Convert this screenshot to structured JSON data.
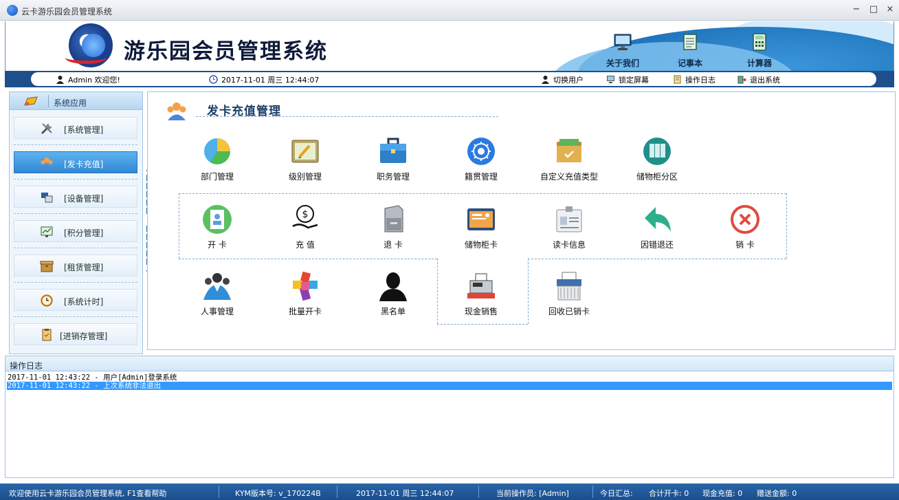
{
  "window": {
    "title": "云卡游乐园会员管理系统",
    "minimize": "−",
    "maximize": "□",
    "close": "×"
  },
  "header": {
    "brand": "游乐园会员管理系统",
    "tools": [
      {
        "label": "关于我们",
        "icon": "monitor-icon"
      },
      {
        "label": "记事本",
        "icon": "notepad-icon"
      },
      {
        "label": "计算器",
        "icon": "calculator-icon"
      }
    ]
  },
  "infobar": {
    "welcome": "Admin 欢迎您!",
    "datetime": "2017-11-01 周三 12:44:07",
    "switch_user": "切换用户",
    "lock_screen": "锁定屏幕",
    "op_log": "操作日志",
    "exit": "退出系统"
  },
  "sidebar": {
    "header": "系统应用",
    "items": [
      {
        "label": "[系统管理]",
        "icon": "tools-icon",
        "active": false
      },
      {
        "label": "[发卡充值]",
        "icon": "users-icon",
        "active": true
      },
      {
        "label": "[设备管理]",
        "icon": "devices-icon",
        "active": false
      },
      {
        "label": "[积分管理]",
        "icon": "points-icon",
        "active": false
      },
      {
        "label": "[租赁管理]",
        "icon": "box-icon",
        "active": false
      },
      {
        "label": "[系统计时]",
        "icon": "clock-icon",
        "active": false
      },
      {
        "label": "[进销存管理]",
        "icon": "inventory-icon",
        "active": false
      }
    ]
  },
  "content": {
    "title": "发卡充值管理",
    "row1": [
      {
        "label": "部门管理",
        "icon": "department-icon"
      },
      {
        "label": "级别管理",
        "icon": "level-icon"
      },
      {
        "label": "职务管理",
        "icon": "briefcase-icon"
      },
      {
        "label": "籍贯管理",
        "icon": "origin-icon"
      },
      {
        "label": "自定义充值类型",
        "icon": "folder-check-icon"
      },
      {
        "label": "储物柜分区",
        "icon": "locker-zone-icon"
      }
    ],
    "row2": [
      {
        "label": "开  卡",
        "icon": "open-card-icon"
      },
      {
        "label": "充  值",
        "icon": "recharge-icon"
      },
      {
        "label": "退  卡",
        "icon": "refund-card-icon"
      },
      {
        "label": "储物柜卡",
        "icon": "locker-card-icon"
      },
      {
        "label": "读卡信息",
        "icon": "read-card-icon"
      },
      {
        "label": "因错退还",
        "icon": "undo-arrow-icon"
      },
      {
        "label": "销  卡",
        "icon": "cancel-card-icon"
      }
    ],
    "row3": [
      {
        "label": "人事管理",
        "icon": "personnel-icon"
      },
      {
        "label": "批量开卡",
        "icon": "batch-card-icon"
      },
      {
        "label": "黑名单",
        "icon": "blacklist-icon"
      },
      {
        "label": "现金销售",
        "icon": "cash-register-icon"
      },
      {
        "label": "回收已销卡",
        "icon": "shredder-icon"
      }
    ]
  },
  "log": {
    "title": "操作日志",
    "lines": [
      {
        "text": "2017-11-01 12:43:22 - 用户[Admin]登录系统",
        "selected": false
      },
      {
        "text": "2017-11-01 12:43:22 - 上次系统非法退出",
        "selected": true
      }
    ]
  },
  "statusbar": {
    "welcome": "欢迎使用云卡游乐园会员管理系统, F1查看帮助",
    "version": "KYM版本号: v_170224B",
    "datetime": "2017-11-01 周三 12:44:07",
    "operator": "当前操作员: [Admin]",
    "summary": "今日汇总:",
    "open_total": "合计开卡: 0",
    "cash_recharge": "现金充值: 0",
    "gift_amount": "赠送金额: 0"
  },
  "colors": {
    "accent": "#2f88d6",
    "bar": "#1c4f8c",
    "selection": "#3399ff"
  }
}
